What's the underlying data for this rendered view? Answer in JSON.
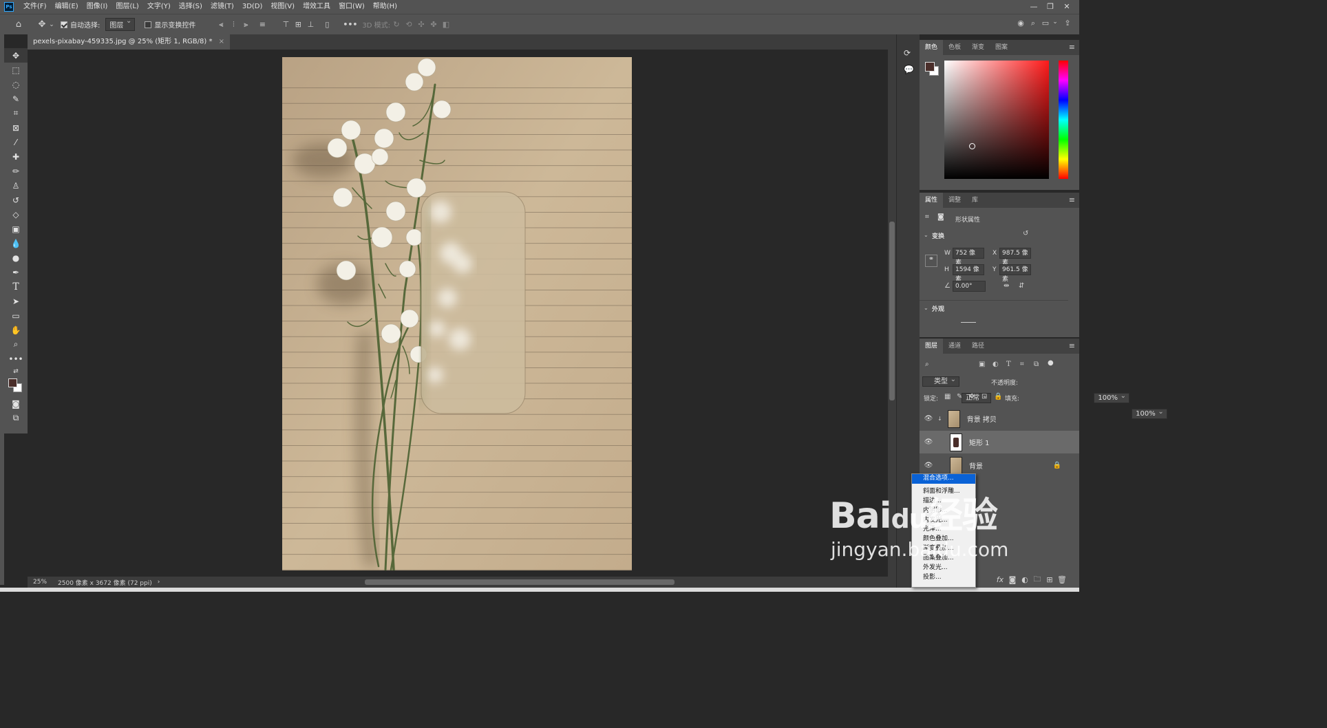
{
  "app": {
    "logo": "Ps"
  },
  "menu": [
    "文件(F)",
    "编辑(E)",
    "图像(I)",
    "图层(L)",
    "文字(Y)",
    "选择(S)",
    "滤镜(T)",
    "3D(D)",
    "视图(V)",
    "增效工具",
    "窗口(W)",
    "帮助(H)"
  ],
  "window_controls": [
    "—",
    "❐",
    "✕"
  ],
  "options": {
    "auto_select_label": "自动选择:",
    "auto_select_value": "图层",
    "show_transform_label": "显示变换控件",
    "mode3d_label": "3D 模式:",
    "more": "•••"
  },
  "document": {
    "tab_title": "pexels-pixabay-459335.jpg @ 25% (矩形 1, RGB/8) *",
    "tab_close": "×"
  },
  "status": {
    "zoom": "25%",
    "info": "2500 像素 x 3672 像素 (72 ppi)",
    "arrow": "›"
  },
  "color_panel": {
    "tabs": [
      "颜色",
      "色板",
      "渐变",
      "图案"
    ],
    "fg": "#4a2e2a",
    "bg": "#ffffff",
    "hue": "#ff1a1a"
  },
  "props_panel": {
    "tabs": [
      "属性",
      "调整",
      "库"
    ],
    "title": "形状属性",
    "transform_label": "变换",
    "w_label": "W",
    "w": "752 像素",
    "x_label": "X",
    "x": "987.5 像素",
    "h_label": "H",
    "h": "1594 像素",
    "y_label": "Y",
    "y": "961.5 像素",
    "angle": "0.00°",
    "appearance_label": "外观"
  },
  "layers_panel": {
    "tabs": [
      "图层",
      "通道",
      "路径"
    ],
    "filter": "类型",
    "blend": "正常",
    "opacity_label": "不透明度:",
    "opacity": "100%",
    "lock_label": "锁定:",
    "fill_label": "填充:",
    "fill": "100%",
    "layers": [
      {
        "name": "背景 拷贝"
      },
      {
        "name": "矩形 1"
      },
      {
        "name": "背景"
      }
    ],
    "fx": "fx"
  },
  "context_menu": [
    "混合选项...",
    "斜面和浮雕...",
    "描边...",
    "内阴影...",
    "内发光...",
    "光泽...",
    "颜色叠加...",
    "渐变叠加...",
    "图案叠加...",
    "外发光...",
    "投影..."
  ],
  "watermark": {
    "brand": "Bai",
    "paw": "du",
    "cn": "经验",
    "url": "jingyan.baidu.com"
  }
}
